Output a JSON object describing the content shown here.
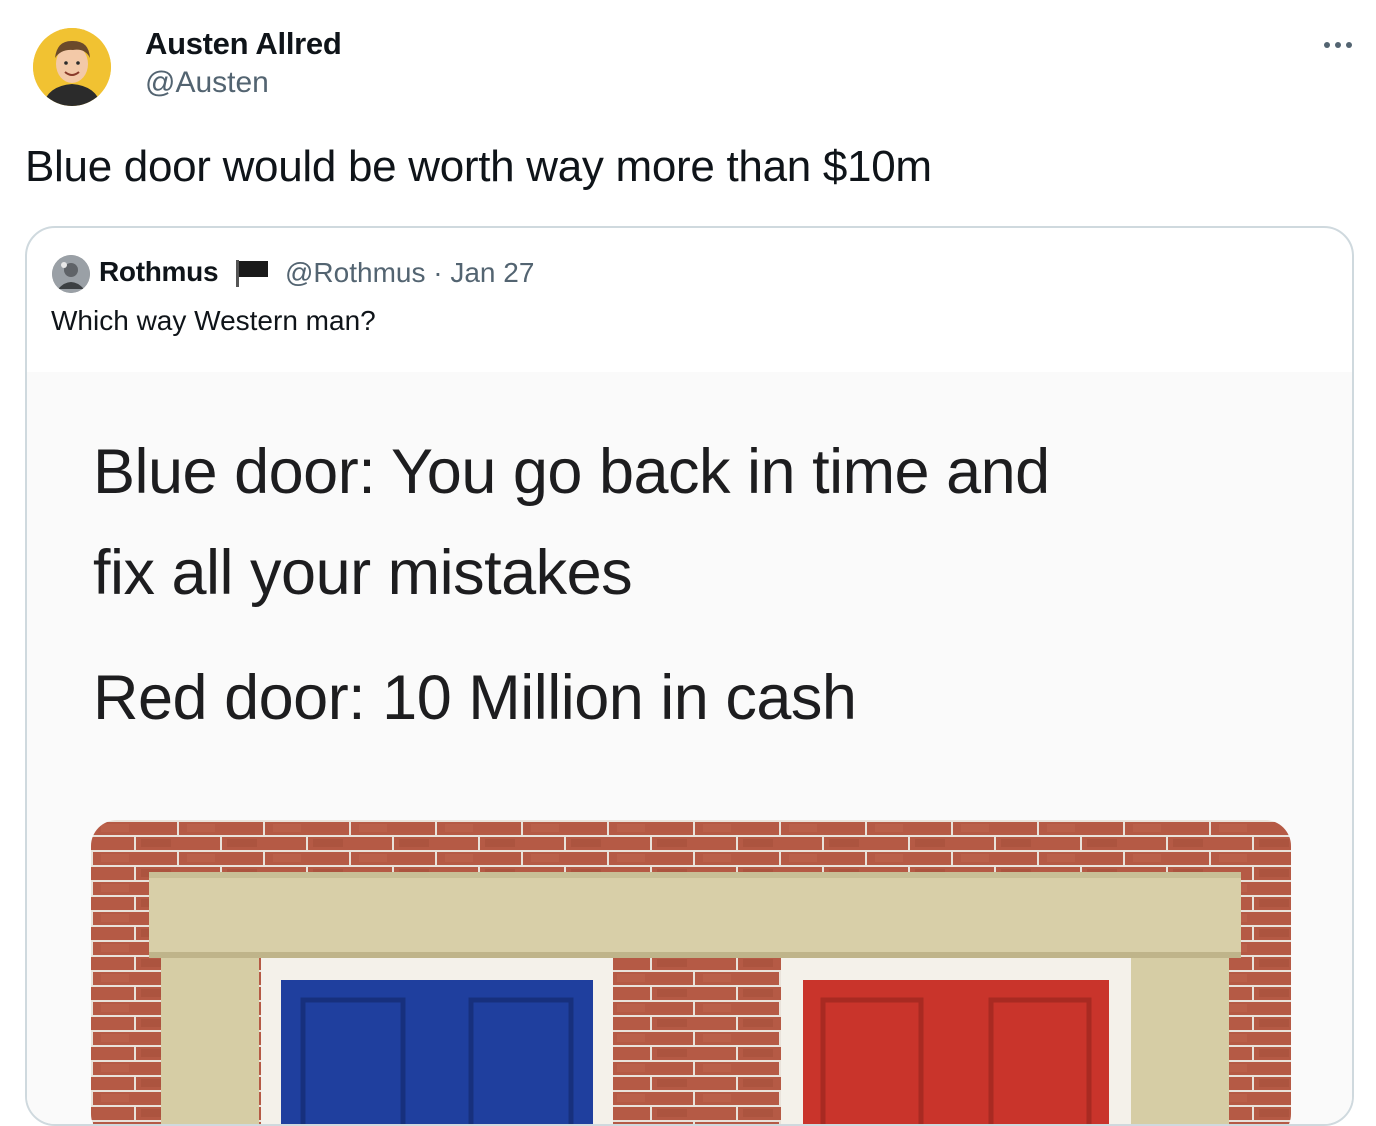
{
  "tweet": {
    "author": {
      "name": "Austen Allred",
      "handle": "@Austen"
    },
    "text": "Blue door would be worth way more than $10m",
    "more_icon": "more-horizontal-icon"
  },
  "quoted_tweet": {
    "author": {
      "name": "Rothmus",
      "badge_icon": "black-flag-icon",
      "meta": "@Rothmus · Jan 27"
    },
    "text": "Which way Western man?",
    "media": {
      "lines": [
        "Blue door: You go back in time and",
        "fix all your mistakes",
        "Red door: 10 Million in cash"
      ],
      "colors": {
        "blue_door": "#1f3f9e",
        "red_door": "#c9342b",
        "brick": "#b55a45",
        "stone": "#d8cfa8"
      }
    }
  },
  "colors": {
    "text_primary": "#0f1419",
    "text_secondary": "#536471",
    "border": "#cfd9de"
  }
}
